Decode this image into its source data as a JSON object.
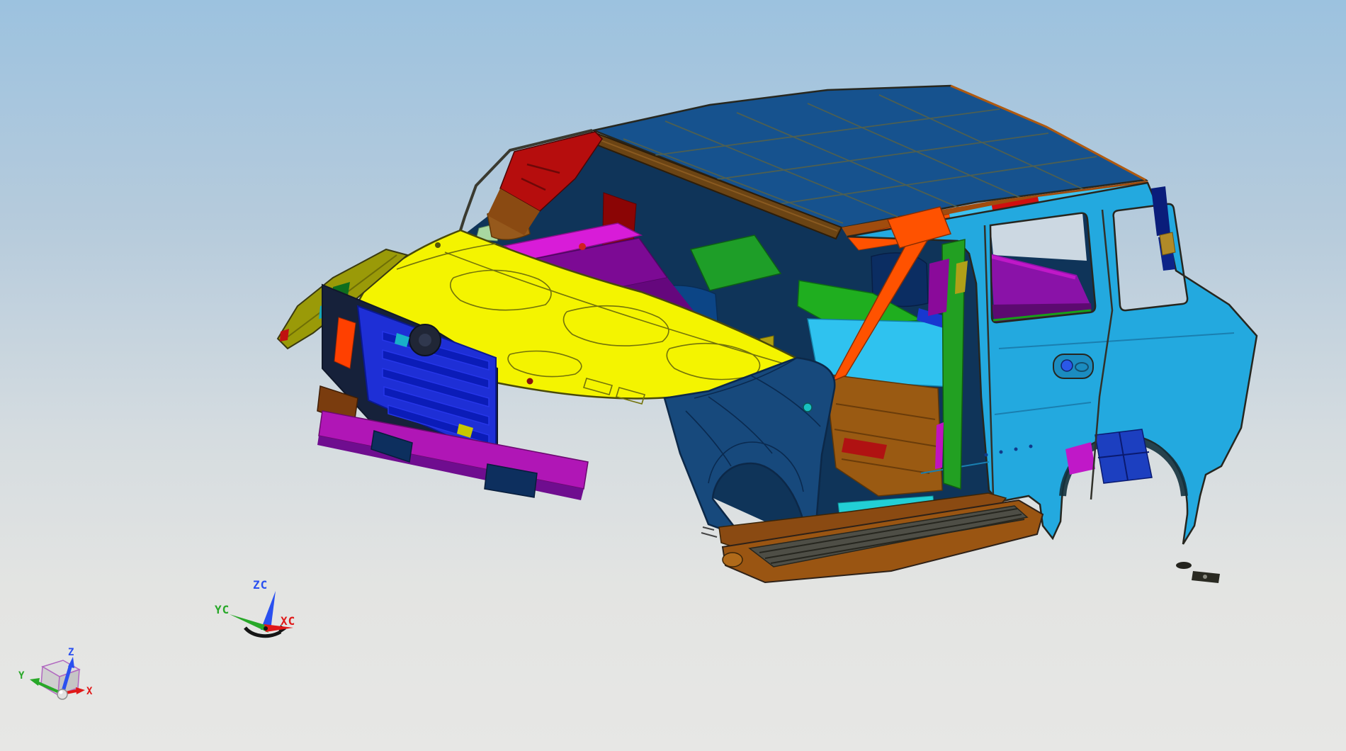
{
  "viewport": {
    "type": "cad-3d-viewport",
    "background_top": "#9cc2df",
    "background_bottom": "#e7e7e5"
  },
  "wcs_triad": {
    "z_label": "ZC",
    "y_label": "YC",
    "x_label": "XC",
    "z_color": "#2a50f0",
    "y_color": "#28a828",
    "x_color": "#e01818"
  },
  "abs_triad": {
    "z_label": "Z",
    "y_label": "Y",
    "x_label": "X",
    "z_color": "#2a50f0",
    "y_color": "#28a828",
    "x_color": "#e01818",
    "cube_edge_color": "#b168c0"
  },
  "model": {
    "name": "suv-body-in-white",
    "parts": [
      {
        "name": "roof-panel",
        "color": "#16528e"
      },
      {
        "name": "windshield-header-rail",
        "color": "#6b4414"
      },
      {
        "name": "hood-panel",
        "color": "#f4f400"
      },
      {
        "name": "front-fender",
        "color": "#17497c"
      },
      {
        "name": "rear-body-side",
        "color": "#23a9df"
      },
      {
        "name": "fender-top-rail",
        "color": "#9a9a08"
      },
      {
        "name": "radiator-support",
        "color": "#1e2fd6"
      },
      {
        "name": "front-bumper-beam",
        "color": "#b016b6"
      },
      {
        "name": "side-step",
        "color": "#9a5512"
      },
      {
        "name": "b-pillar-reinforcement",
        "color": "#ff5200"
      },
      {
        "name": "front-floor-panel",
        "color": "#22cc00"
      },
      {
        "name": "mid-floor-panel",
        "color": "#2fc2ef"
      },
      {
        "name": "transmission-tunnel",
        "color": "#9a5a12"
      },
      {
        "name": "a-pillar-inner",
        "color": "#b60d0d"
      },
      {
        "name": "cowl-top-panel",
        "color": "#d81cd8"
      },
      {
        "name": "rear-wheelhouse-trim",
        "color": "#8a12a8"
      },
      {
        "name": "rear-arch-bracket",
        "color": "#1c3fc0"
      },
      {
        "name": "cant-rail-accent-red",
        "color": "#cf0f0f"
      },
      {
        "name": "cant-rail-accent-cyan",
        "color": "#3ec2f0"
      },
      {
        "name": "sill-rocker",
        "color": "#8a4a12"
      }
    ]
  }
}
